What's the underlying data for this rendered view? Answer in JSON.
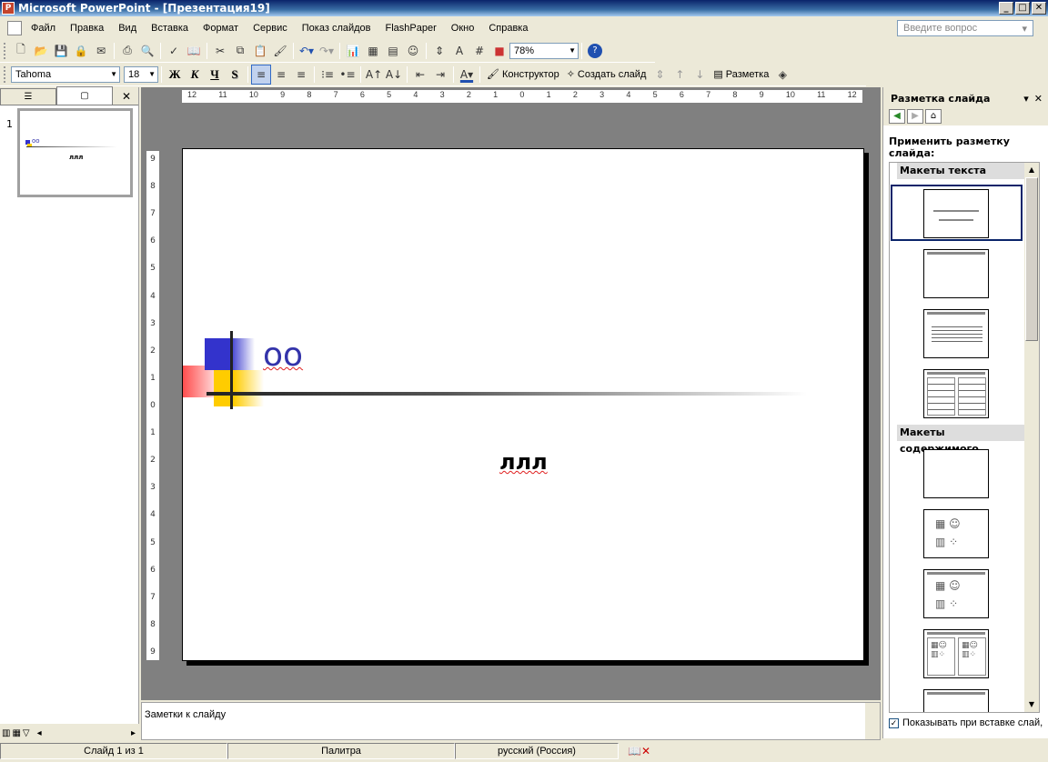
{
  "window": {
    "title": "Microsoft PowerPoint - [Презентация19]"
  },
  "menu": {
    "items": [
      "Файл",
      "Правка",
      "Вид",
      "Вставка",
      "Формат",
      "Сервис",
      "Показ слайдов",
      "FlashPaper",
      "Окно",
      "Справка"
    ],
    "ask_placeholder": "Введите вопрос"
  },
  "toolbar": {
    "zoom": "78%"
  },
  "format_toolbar": {
    "font": "Tahoma",
    "size": "18",
    "bold": "Ж",
    "italic": "К",
    "underline": "Ч",
    "shadow": "S",
    "designer": "Конструктор",
    "new_slide": "Создать слайд",
    "layout": "Разметка"
  },
  "ruler": {
    "h_ticks": [
      "12",
      "11",
      "10",
      "9",
      "8",
      "7",
      "6",
      "5",
      "4",
      "3",
      "2",
      "1",
      "0",
      "1",
      "2",
      "3",
      "4",
      "5",
      "6",
      "7",
      "8",
      "9",
      "10",
      "11",
      "12"
    ],
    "v_ticks": [
      "9",
      "8",
      "7",
      "6",
      "5",
      "4",
      "3",
      "2",
      "1",
      "0",
      "1",
      "2",
      "3",
      "4",
      "5",
      "6",
      "7",
      "8",
      "9"
    ]
  },
  "slides_panel": {
    "slide_number": "1",
    "thumb_title": "оо",
    "thumb_sub": "ллл"
  },
  "slide": {
    "title": "оо",
    "subtitle": "ллл"
  },
  "notes": {
    "text": "Заметки к слайду"
  },
  "task_pane": {
    "title": "Разметка слайда",
    "apply_label": "Применить разметку слайда:",
    "section_text": "Макеты текста",
    "section_content": "Макеты содержимого",
    "show_on_insert": "Показывать при вставке слай,"
  },
  "status": {
    "slide": "Слайд 1 из 1",
    "design": "Палитра",
    "language": "русский (Россия)"
  }
}
